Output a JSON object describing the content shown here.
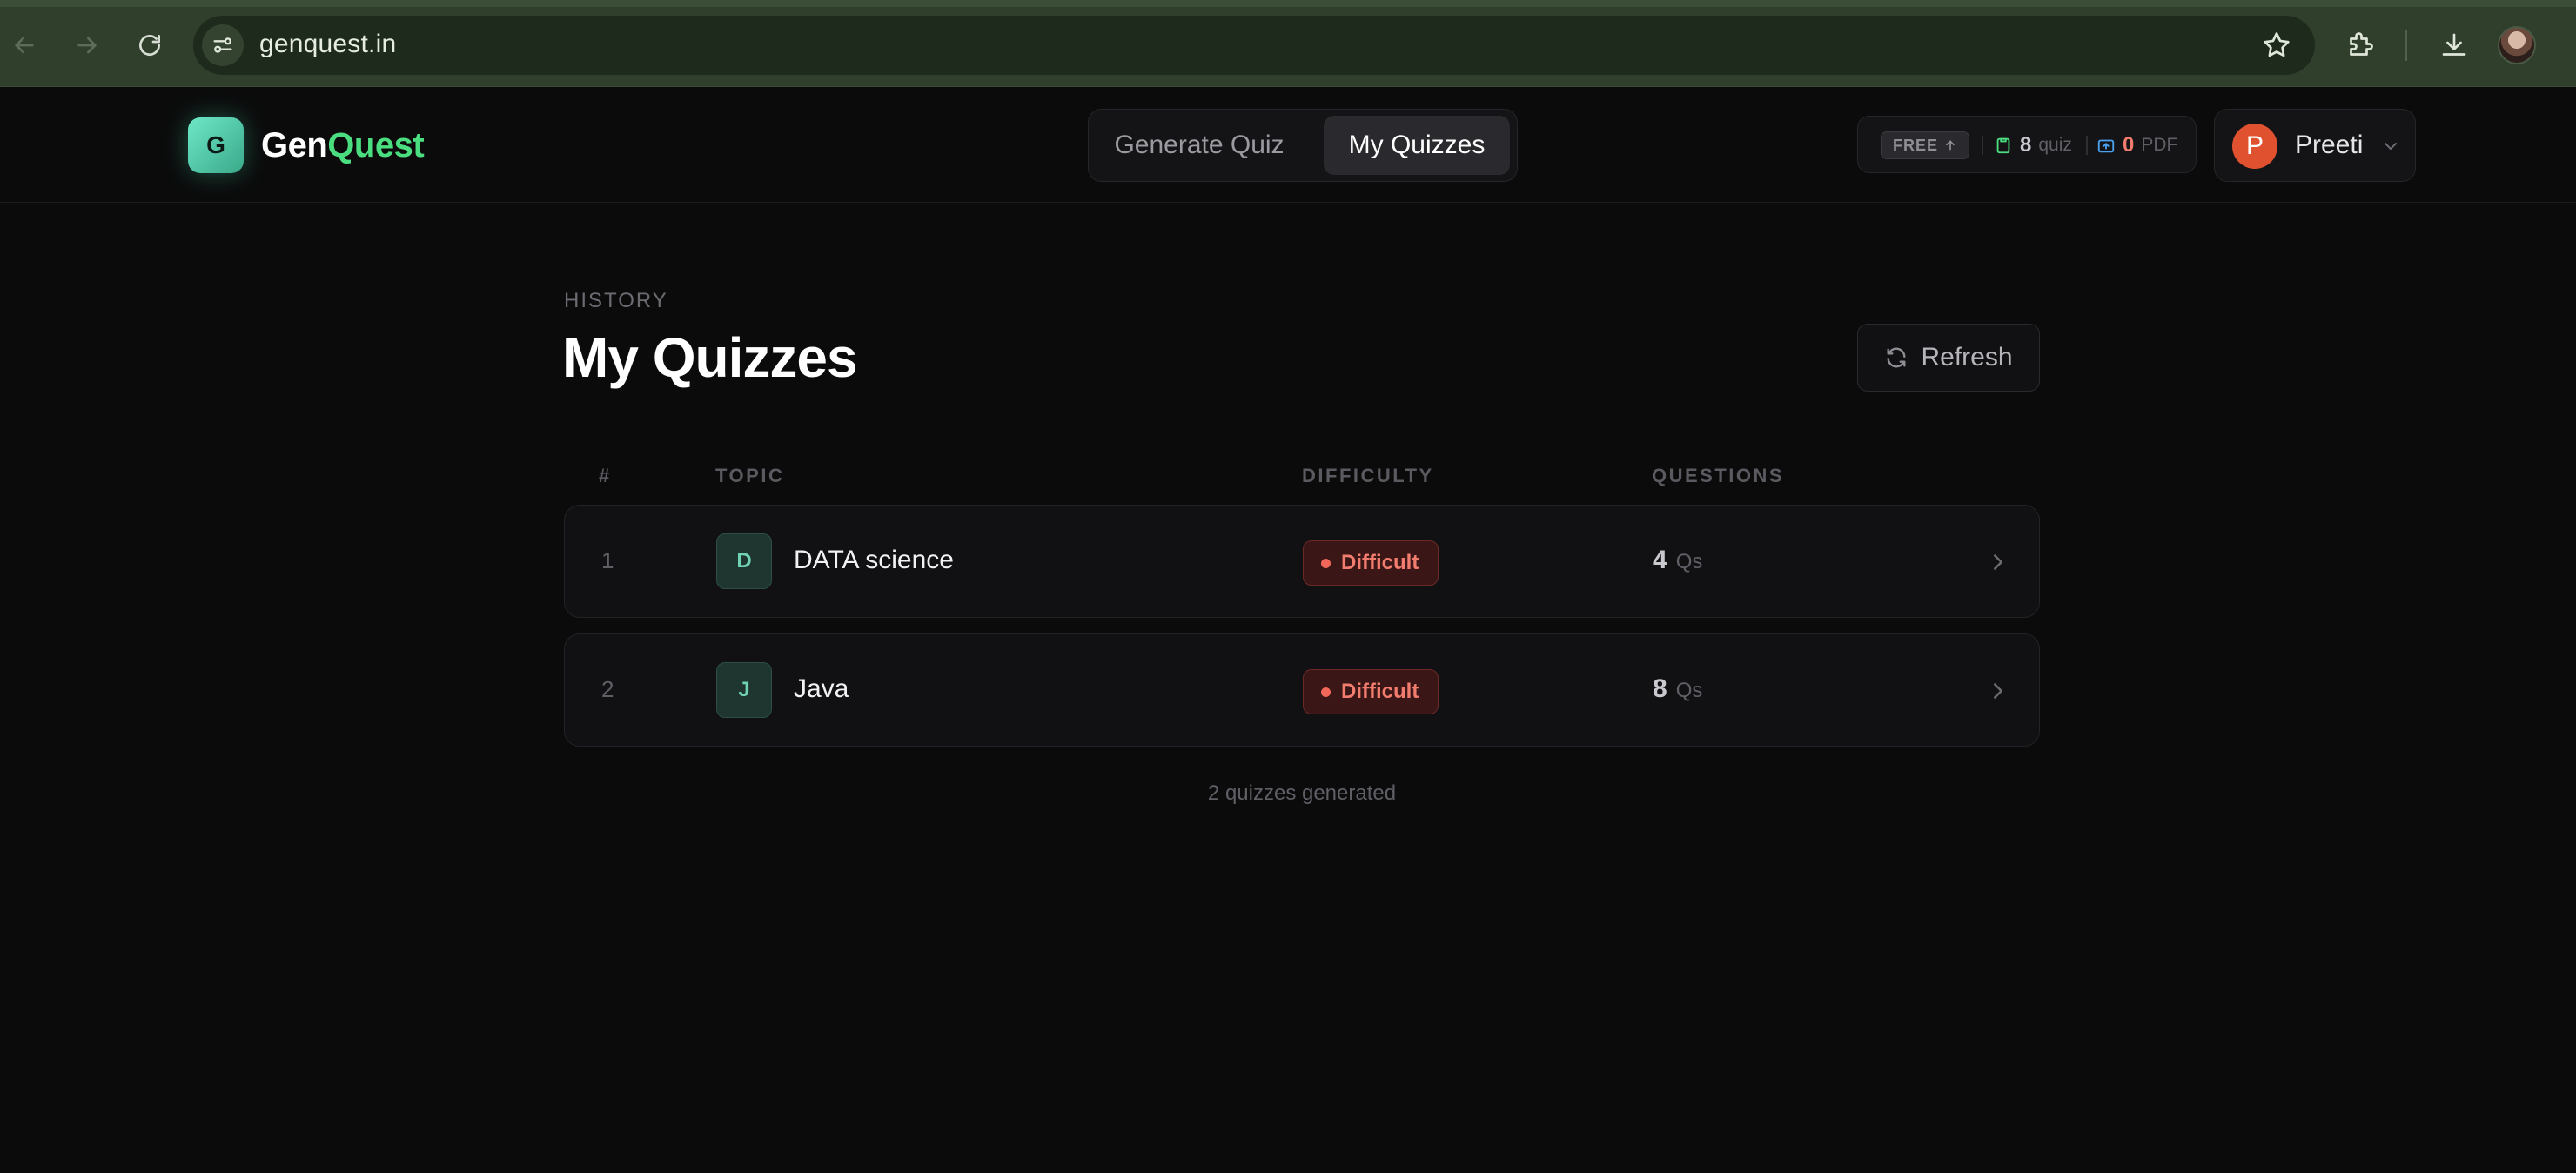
{
  "browser": {
    "url": "genquest.in",
    "icons": [
      "back-arrow-icon",
      "forward-arrow-icon",
      "reload-icon",
      "site-info-icon",
      "bookmark-star-icon",
      "extensions-icon",
      "download-icon",
      "profile-avatar"
    ]
  },
  "header": {
    "logo_letter": "G",
    "logo_text_part1": "Gen",
    "logo_text_part2": "Quest",
    "tabs": [
      {
        "label": "Generate Quiz",
        "active": false
      },
      {
        "label": "My Quizzes",
        "active": true
      }
    ],
    "plan_label": "FREE",
    "quiz_count": "8",
    "quiz_unit": "quiz",
    "pdf_count": "0",
    "pdf_unit": "PDF",
    "user_initial": "P",
    "user_name": "Preeti"
  },
  "page": {
    "eyebrow": "HISTORY",
    "title": "My Quizzes",
    "refresh_label": "Refresh"
  },
  "table": {
    "columns": [
      "#",
      "TOPIC",
      "DIFFICULTY",
      "QUESTIONS"
    ],
    "rows": [
      {
        "index": "1",
        "initial": "D",
        "topic": "DATA science",
        "difficulty": "Difficult",
        "questions": "4",
        "questions_unit": "Qs"
      },
      {
        "index": "2",
        "initial": "J",
        "topic": "Java",
        "difficulty": "Difficult",
        "questions": "8",
        "questions_unit": "Qs"
      }
    ]
  },
  "footer": {
    "summary": "2 quizzes generated"
  },
  "colors": {
    "accent_green": "#4ade80",
    "difficulty_red": "#f27c6d",
    "avatar_orange": "#e0522f",
    "browser_chrome": "#2f3f2c"
  }
}
